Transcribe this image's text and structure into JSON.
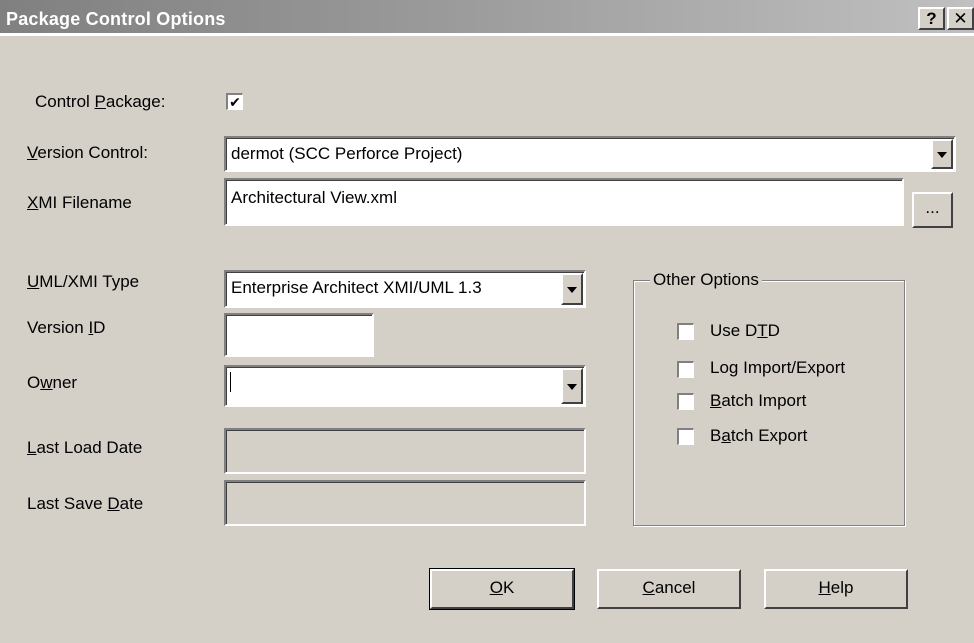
{
  "window": {
    "title": "Package Control Options",
    "help_glyph": "?",
    "close_glyph": "✕"
  },
  "form": {
    "control_package": {
      "label_pre": "Control ",
      "label_key": "P",
      "label_post": "ackage:",
      "checked": true,
      "check_glyph": "✔"
    },
    "version_control": {
      "label_key": "V",
      "label_post": "ersion Control:",
      "value": "dermot (SCC Perforce Project)"
    },
    "xmi_filename": {
      "label_key": "X",
      "label_post": "MI Filename",
      "value": "Architectural View.xml",
      "browse_label": "..."
    },
    "uml_xmi_type": {
      "label_key": "U",
      "label_post": "ML/XMI Type",
      "value": "Enterprise Architect XMI/UML 1.3"
    },
    "version_id": {
      "label_pre": "Version ",
      "label_key": "I",
      "label_post": "D",
      "value": ""
    },
    "owner": {
      "label_pre": "O",
      "label_key": "w",
      "label_post": "ner",
      "value": ""
    },
    "last_load_date": {
      "label_key": "L",
      "label_post": "ast Load Date",
      "value": ""
    },
    "last_save_date": {
      "label_pre": "Last Save ",
      "label_key": "D",
      "label_post": "ate",
      "value": ""
    }
  },
  "other_options": {
    "legend": "Other Options",
    "use_dtd": {
      "label_pre": "Use D",
      "label_key": "T",
      "label_post": "D",
      "checked": false
    },
    "log_import_export": {
      "label_pre": "Lo",
      "label_key": "g",
      "label_post": " Import/Export",
      "checked": false
    },
    "batch_import": {
      "label_key": "B",
      "label_post": "atch Import",
      "checked": false
    },
    "batch_export": {
      "label_pre": "B",
      "label_key": "a",
      "label_post": "tch Export",
      "checked": false
    }
  },
  "buttons": {
    "ok": {
      "key": "O",
      "rest": "K"
    },
    "cancel": {
      "key": "C",
      "rest": "ancel"
    },
    "help": {
      "key": "H",
      "rest": "elp"
    }
  }
}
